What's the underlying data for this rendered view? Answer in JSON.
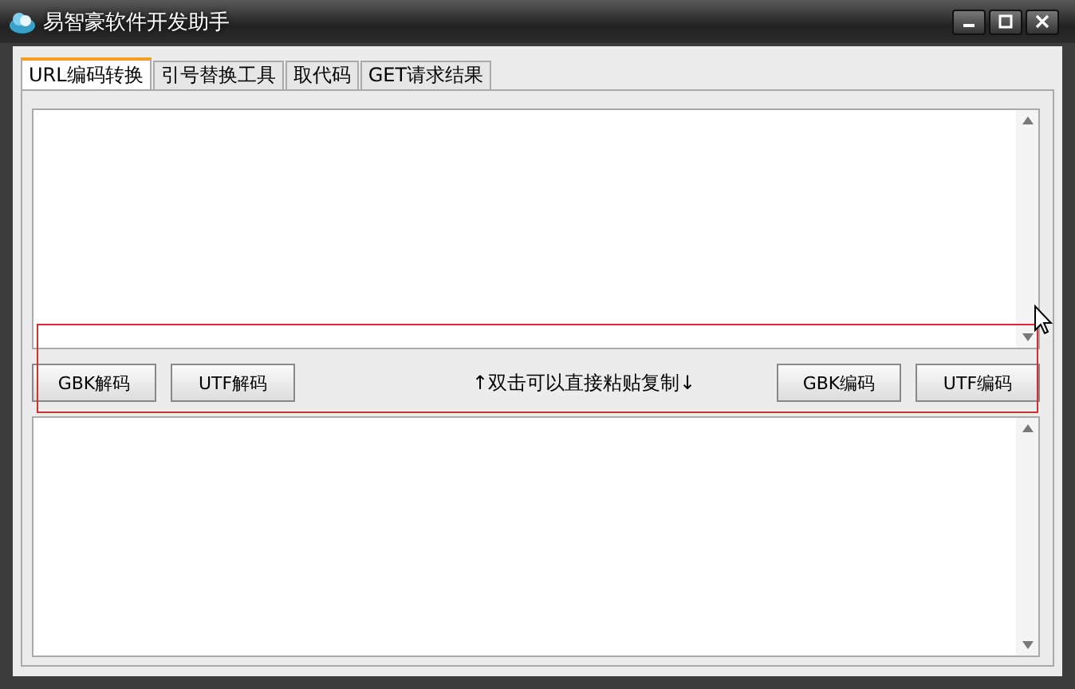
{
  "window": {
    "title": "易智豪软件开发助手"
  },
  "tabs": [
    {
      "label": "URL编码转换",
      "selected": true
    },
    {
      "label": "引号替换工具",
      "selected": false
    },
    {
      "label": "取代码",
      "selected": false
    },
    {
      "label": "GET请求结果",
      "selected": false
    }
  ],
  "decode_buttons": [
    "GBK解码",
    "UTF解码"
  ],
  "hint": "↑双击可以直接粘贴复制↓",
  "encode_buttons": [
    "GBK编码",
    "UTF编码"
  ]
}
